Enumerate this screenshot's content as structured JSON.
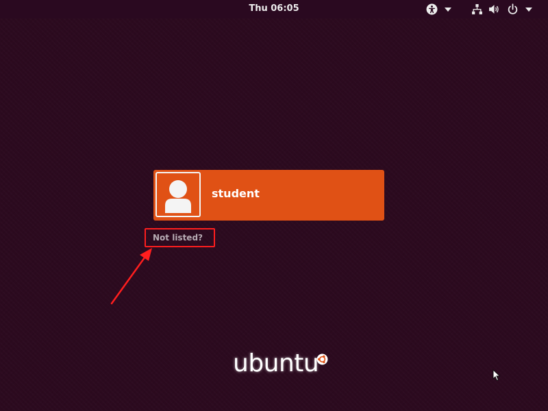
{
  "panel": {
    "clock": "Thu 06:05",
    "icons": {
      "accessibility": "accessibility-icon",
      "network": "network-wired-icon",
      "volume": "volume-icon",
      "power": "power-icon",
      "menu_arrow": "triangle-down-icon"
    }
  },
  "login": {
    "users": [
      {
        "name": "student",
        "avatar": "default-user-avatar-icon"
      }
    ],
    "not_listed": "Not listed?"
  },
  "branding": {
    "logo_text": "ubuntu"
  },
  "colors": {
    "background": "#2c0a1f",
    "panel": "#2a0920",
    "user_entry": "#e05115",
    "annotation": "#ff1e1e"
  }
}
